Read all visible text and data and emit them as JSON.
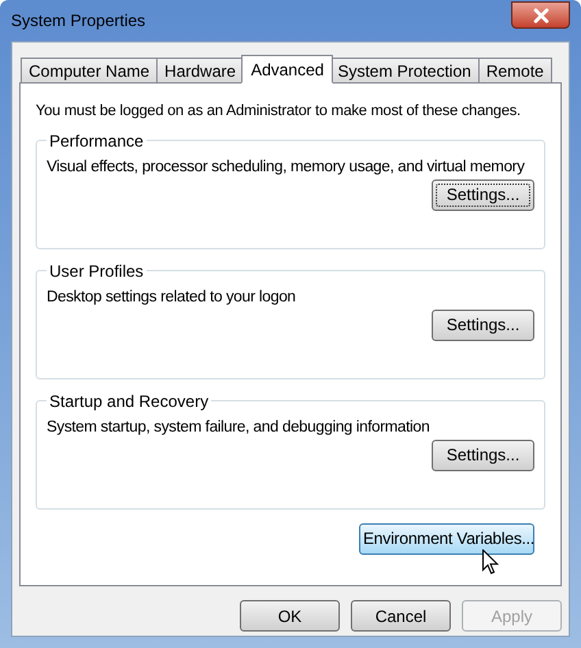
{
  "window": {
    "title": "System Properties"
  },
  "tabs": [
    {
      "label": "Computer Name",
      "selected": false
    },
    {
      "label": "Hardware",
      "selected": false
    },
    {
      "label": "Advanced",
      "selected": true
    },
    {
      "label": "System Protection",
      "selected": false
    },
    {
      "label": "Remote",
      "selected": false
    }
  ],
  "notice": "You must be logged on as an Administrator to make most of these changes.",
  "groups": [
    {
      "title": "Performance",
      "description": "Visual effects, processor scheduling, memory usage, and virtual memory",
      "button": {
        "label": "Settings...",
        "focused": true
      }
    },
    {
      "title": "User Profiles",
      "description": "Desktop settings related to your logon",
      "button": {
        "label": "Settings...",
        "focused": false
      }
    },
    {
      "title": "Startup and Recovery",
      "description": "System startup, system failure, and debugging information",
      "button": {
        "label": "Settings...",
        "focused": false
      }
    }
  ],
  "environment_button": {
    "label": "Environment Variables...",
    "hovered": true
  },
  "buttons": [
    {
      "label": "OK",
      "disabled": false
    },
    {
      "label": "Cancel",
      "disabled": false
    },
    {
      "label": "Apply",
      "disabled": true
    }
  ]
}
